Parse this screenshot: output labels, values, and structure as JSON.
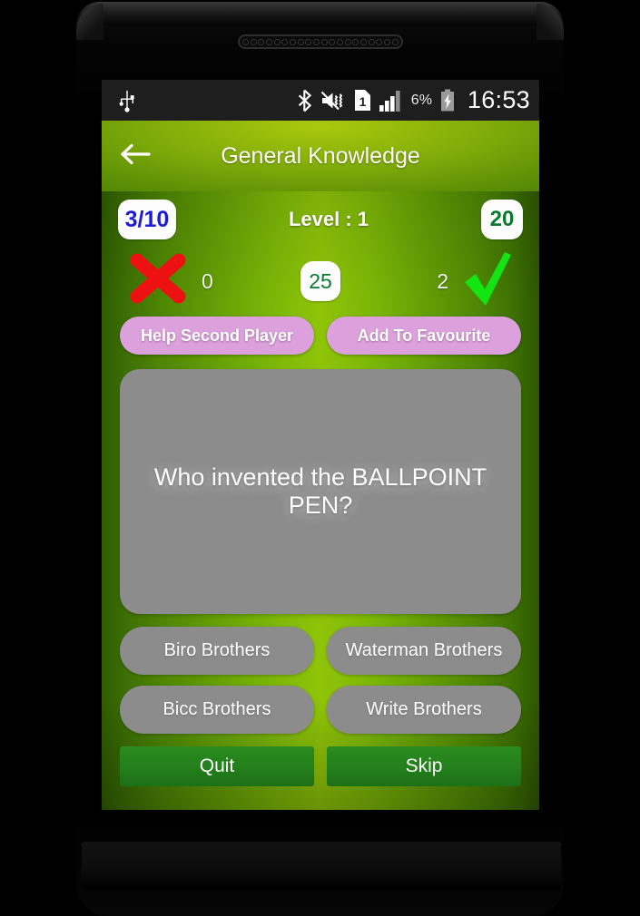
{
  "status_bar": {
    "usb_icon": "usb-icon",
    "bluetooth_icon": "bluetooth-icon",
    "silent_icon": "sound-muted-icon",
    "sim_icon": "sim-card-1-icon",
    "signal_icon": "signal-bars-icon",
    "battery_percent": "6%",
    "battery_icon": "battery-charging-icon",
    "clock": "16:53"
  },
  "header": {
    "back_icon": "back-arrow-icon",
    "title": "General Knowledge"
  },
  "score": {
    "progress": "3/10",
    "level": "Level : 1",
    "coins": "20"
  },
  "stats": {
    "wrong_icon": "red-cross-icon",
    "wrong_count": "0",
    "timer": "25",
    "right_count": "2",
    "right_icon": "green-check-icon"
  },
  "actions": {
    "help_second_player": "Help Second Player",
    "add_to_favourite": "Add To Favourite"
  },
  "question": {
    "text": "Who invented the BALLPOINT PEN?"
  },
  "answers": [
    {
      "label": "Biro Brothers"
    },
    {
      "label": "Waterman Brothers"
    },
    {
      "label": "Bicc Brothers"
    },
    {
      "label": "Write Brothers"
    }
  ],
  "footer": {
    "quit": "Quit",
    "skip": "Skip"
  },
  "colors": {
    "accent_green": "#8fc408",
    "dark_green": "#2f5b02",
    "pink_button": "#dca0dc",
    "card_gray": "#8c8c8c",
    "progress_blue": "#1b1bd8",
    "coins_green": "#0a7a2e",
    "cross_red": "#ee1111",
    "check_green": "#12e512",
    "footer_green": "#23801b"
  }
}
